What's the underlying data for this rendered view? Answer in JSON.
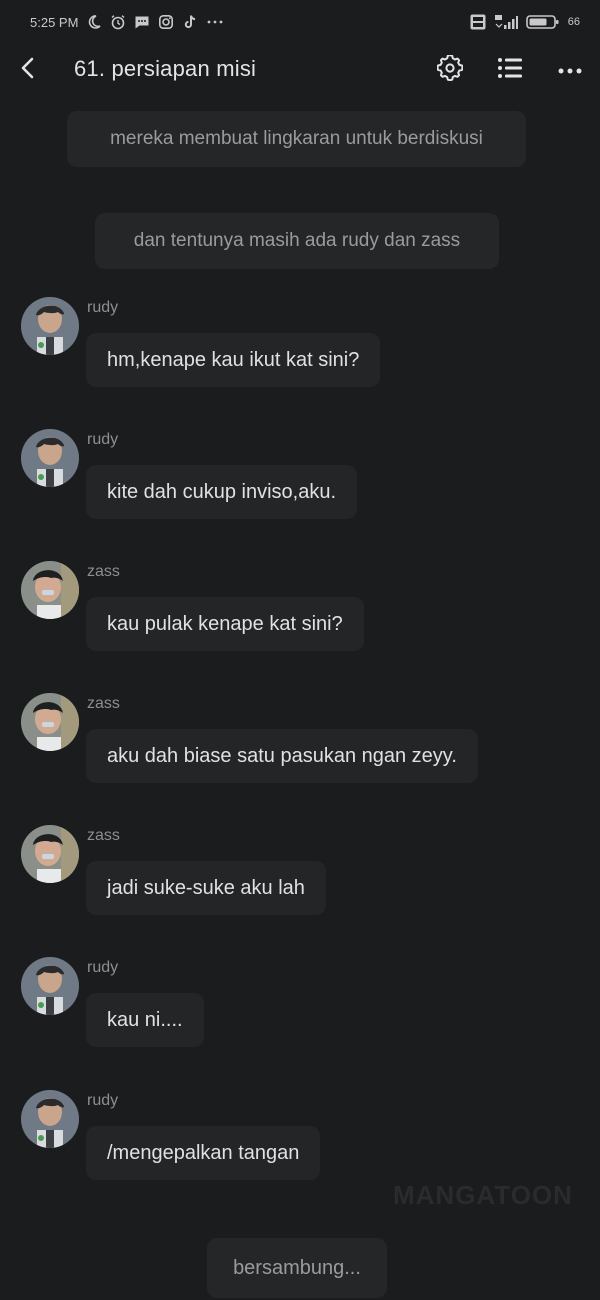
{
  "status_bar": {
    "time": "5:25 PM",
    "battery": "66",
    "icons": [
      "moon-icon",
      "alarm-icon",
      "message-icon",
      "instagram-icon",
      "tiktok-icon",
      "more-dots-icon",
      "volte-icon",
      "signal-icon",
      "battery-icon"
    ]
  },
  "header": {
    "title": "61. persiapan misi",
    "icons": [
      "back-icon",
      "gear-icon",
      "list-icon",
      "more-icon"
    ]
  },
  "narrations": [
    "mereka membuat lingkaran untuk berdiskusi",
    "dan tentunya masih ada rudy dan zass"
  ],
  "messages": [
    {
      "speaker": "rudy",
      "text": "hm,kenape kau ikut kat sini?"
    },
    {
      "speaker": "rudy",
      "text": "kite dah cukup inviso,aku."
    },
    {
      "speaker": "zass",
      "text": "kau pulak kenape kat sini?"
    },
    {
      "speaker": "zass",
      "text": "aku dah biase satu pasukan ngan zeyy."
    },
    {
      "speaker": "zass",
      "text": "jadi suke-suke aku lah"
    },
    {
      "speaker": "rudy",
      "text": "kau ni...."
    },
    {
      "speaker": "rudy",
      "text": "/mengepalkan tangan"
    }
  ],
  "watermark": "MANGATOON",
  "continue_label": "bersambung..."
}
